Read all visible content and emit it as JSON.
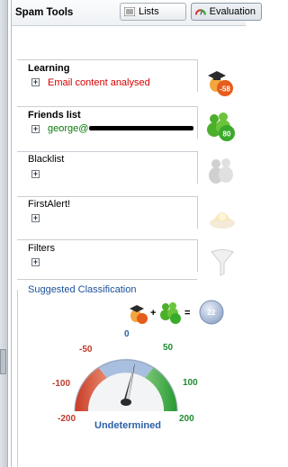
{
  "header": {
    "title": "Spam Tools",
    "tabs": [
      {
        "label": "Lists",
        "icon": "list-icon"
      },
      {
        "label": "Evaluation",
        "icon": "gauge-icon",
        "active": true
      }
    ]
  },
  "sections": [
    {
      "title": "Learning",
      "value": "Email content analysed",
      "value_color": "#d40000",
      "icon": "graduate-icon",
      "badge": "-58",
      "badge_color": "#e65c1a"
    },
    {
      "title": "Friends list",
      "value": "george@",
      "value_color": "#0a7a0a",
      "icon": "people-icon",
      "badge": "80",
      "badge_color": "#3aaa2a"
    },
    {
      "title": "Blacklist",
      "icon": "people-gray-icon"
    },
    {
      "title": "FirstAlert!",
      "icon": "alert-lamp-icon"
    },
    {
      "title": "Filters",
      "icon": "funnel-icon"
    }
  ],
  "classification": {
    "title": "Suggested Classification",
    "formula": {
      "plus": "+",
      "equals": "=",
      "result": "22"
    },
    "gauge": {
      "labels": [
        "-200",
        "-100",
        "-50",
        "0",
        "50",
        "100",
        "200"
      ],
      "value": 22
    },
    "status": "Undetermined"
  }
}
